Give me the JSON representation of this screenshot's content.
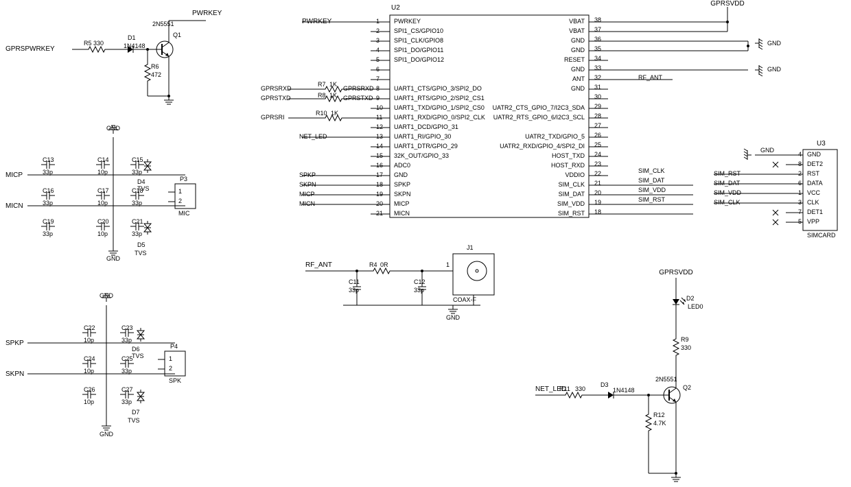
{
  "pwrkey_block": {
    "signal_in": "GPRSPWRKEY",
    "r5": "R5",
    "r5_val": "330",
    "d1": "D1",
    "d1_val": "1N4148",
    "q1": "Q1",
    "q1_val": "2N5551",
    "r6": "R6",
    "r6_val": "472",
    "pwrkey": "PWRKEY"
  },
  "mic_block": {
    "gnd_top": "GND",
    "micp": "MICP",
    "micn": "MICN",
    "c13": "C13",
    "c13_val": "33p",
    "c14": "C14",
    "c14_val": "10p",
    "c15": "C15",
    "c15_val": "33p",
    "c16": "C16",
    "c16_val": "33p",
    "c17": "C17",
    "c17_val": "10p",
    "c18": "C18",
    "c18_val": "33p",
    "c19": "C19",
    "c19_val": "33p",
    "c20": "C20",
    "c20_val": "10p",
    "c21": "C21",
    "c21_val": "33p",
    "p3": "P3",
    "p3_name": "MIC",
    "p3_pin1": "1",
    "p3_pin2": "2",
    "d4": "D4",
    "d4_tvs": "TVS",
    "d5": "D5",
    "d5_tvs": "TVS",
    "gnd_bot": "GND"
  },
  "spk_block": {
    "gnd_top": "GND",
    "spkp": "SPKP",
    "skpn": "SKPN",
    "c22": "C22",
    "c22_val": "10p",
    "c23": "C23",
    "c23_val": "33p",
    "c24": "C24",
    "c24_val": "10p",
    "c25": "C25",
    "c25_val": "33p",
    "c26": "C26",
    "c26_val": "10p",
    "c27": "C27",
    "c27_val": "33p",
    "p4": "P4",
    "p4_name": "SPK",
    "p4_pin1": "1",
    "p4_pin2": "2",
    "d6": "D6",
    "d6_tvs": "TVS",
    "d7": "D7",
    "d7_tvs": "TVS",
    "gnd_bot": "GND"
  },
  "u2": {
    "ref": "U2",
    "left_signals": {
      "pwrkey": "PWRKEY",
      "gprsrxd_in": "GPRSRXD",
      "r7": "R7",
      "r7_val": "1K",
      "gprsrxd": "GPRSRXD",
      "gprstxd_in": "GPRSTXD",
      "r8": "R8",
      "r8_val": "1K",
      "gprstxd": "GPRSTXD",
      "gprsri_in": "GPRSRI",
      "r10": "R10",
      "r10_val": "1K",
      "net_led": "NET_LED",
      "spkp": "SPKP",
      "skpn": "SKPN",
      "micp": "MICP",
      "micn": "MICN"
    },
    "pins_left": [
      {
        "n": "1",
        "name": "PWRKEY"
      },
      {
        "n": "2",
        "name": "SPI1_CS/GPIO10"
      },
      {
        "n": "3",
        "name": "SPI1_CLK/GPIO8"
      },
      {
        "n": "4",
        "name": "SPI1_DO/GPIO11"
      },
      {
        "n": "5",
        "name": "SPI1_DO/GPIO12"
      },
      {
        "n": "6",
        "name": ""
      },
      {
        "n": "7",
        "name": ""
      },
      {
        "n": "8",
        "name": "UART1_CTS/GPIO_3/SPI2_DO"
      },
      {
        "n": "9",
        "name": "UART1_RTS/GPIO_2/SPI2_CS1"
      },
      {
        "n": "10",
        "name": "UART1_TXD/GPIO_1/SPI2_CS0"
      },
      {
        "n": "11",
        "name": "UART1_RXD/GPIO_0/SPI2_CLK"
      },
      {
        "n": "12",
        "name": "UART1_DCD/GPIO_31"
      },
      {
        "n": "13",
        "name": "UART1_RI/GPIO_30"
      },
      {
        "n": "14",
        "name": "UART1_DTR/GPIO_29"
      },
      {
        "n": "15",
        "name": "32K_OUT/GPIO_33"
      },
      {
        "n": "16",
        "name": "ADC0"
      },
      {
        "n": "17",
        "name": "GND"
      },
      {
        "n": "18",
        "name": "SPKP"
      },
      {
        "n": "19",
        "name": "SKPN"
      },
      {
        "n": "20",
        "name": "MICP"
      },
      {
        "n": "21",
        "name": "MICN"
      }
    ],
    "pins_right": [
      {
        "n": "38",
        "name": "VBAT"
      },
      {
        "n": "37",
        "name": "VBAT"
      },
      {
        "n": "36",
        "name": "GND"
      },
      {
        "n": "35",
        "name": "GND"
      },
      {
        "n": "34",
        "name": "RESET"
      },
      {
        "n": "33",
        "name": "GND"
      },
      {
        "n": "32",
        "name": "ANT"
      },
      {
        "n": "31",
        "name": "GND"
      },
      {
        "n": "30",
        "name": ""
      },
      {
        "n": "29",
        "name": "UATR2_CTS_GPIO_7/I2C3_SDA"
      },
      {
        "n": "28",
        "name": "UATR2_RTS_GPIO_6/I2C3_SCL"
      },
      {
        "n": "27",
        "name": ""
      },
      {
        "n": "26",
        "name": "UATR2_TXD/GPIO_5"
      },
      {
        "n": "25",
        "name": "UATR2_RXD/GPIO_4/SPI2_DI"
      },
      {
        "n": "24",
        "name": "HOST_TXD"
      },
      {
        "n": "23",
        "name": "HOST_RXD"
      },
      {
        "n": "22",
        "name": "VDDIO"
      },
      {
        "n": "21b",
        "name": "SIM_CLK"
      },
      {
        "n": "20b",
        "name": "SIM_DAT"
      },
      {
        "n": "19b",
        "name": "SIM_VDD"
      },
      {
        "n": "18b",
        "name": "SIM_RST"
      }
    ],
    "right_signals": {
      "gprsvdd": "GPRSVDD",
      "gnd1": "GND",
      "gnd2": "GND",
      "rf_ant": "RF_ANT",
      "sim_clk": "SIM_CLK",
      "sim_dat": "SIM_DAT",
      "sim_vdd": "SIM_VDD",
      "sim_rst": "SIM_RST"
    }
  },
  "u3": {
    "ref": "U3",
    "name": "SIMCARD",
    "pins": [
      {
        "n": "4",
        "name": "GND"
      },
      {
        "n": "8",
        "name": "DET2"
      },
      {
        "n": "2",
        "name": "RST"
      },
      {
        "n": "6",
        "name": "DATA"
      },
      {
        "n": "1",
        "name": "VCC"
      },
      {
        "n": "3",
        "name": "CLK"
      },
      {
        "n": "7",
        "name": "DET1"
      },
      {
        "n": "5",
        "name": "VPP"
      }
    ],
    "gnd": "GND",
    "sim_rst": "SIM_RST",
    "sim_dat": "SIM_DAT",
    "sim_vdd": "SIM_VDD",
    "sim_clk": "SIM_CLK"
  },
  "ant_block": {
    "rf_ant": "RF_ANT",
    "r4": "R4",
    "r4_val": "0R",
    "c11": "C11",
    "c11_val": "33p",
    "c12": "C12",
    "c12_val": "33p",
    "j1": "J1",
    "j1_name": "COAX-F",
    "j1_pin1": "1",
    "gnd": "GND"
  },
  "led_block": {
    "gprsvdd": "GPRSVDD",
    "d2": "D2",
    "d2_val": "LED0",
    "r9": "R9",
    "r9_val": "330",
    "q2": "Q2",
    "q2_val": "2N5551",
    "d3": "D3",
    "d3_val": "1N4148",
    "r11": "R11",
    "r11_val": "330",
    "r12": "R12",
    "r12_val": "4.7K",
    "net_led": "NET_LED"
  }
}
